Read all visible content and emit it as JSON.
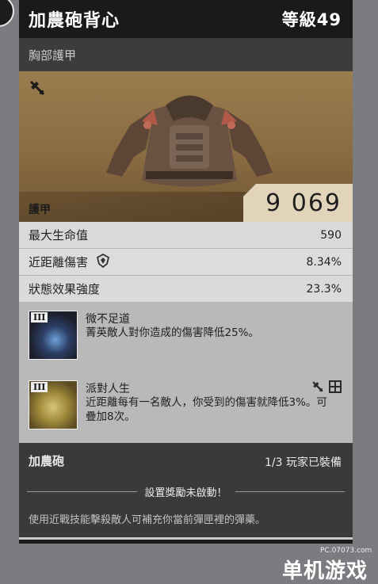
{
  "item": {
    "name": "加農砲背心",
    "level": "等級49",
    "slot": "胸部護甲",
    "armor_label": "護甲",
    "armor_value": "9 069"
  },
  "stats": [
    {
      "label": "最大生命值",
      "value": "590",
      "icon": ""
    },
    {
      "label": "近距離傷害",
      "value": "8.34%",
      "icon": "melee-shield-icon"
    },
    {
      "label": "狀態效果強度",
      "value": "23.3%",
      "icon": ""
    }
  ],
  "talents": [
    {
      "tier": "III",
      "name": "微不足道",
      "description": "菁英敵人對你造成的傷害降低25%。"
    },
    {
      "tier": "III",
      "name": "派對人生",
      "description": "近距離每有一名敵人，你受到的傷害就降低3%。可疊加8次。",
      "icons": [
        "mods-icon",
        "grid-slot-icon"
      ]
    }
  ],
  "gear_set": {
    "name": "加農砲",
    "count": "1/3 玩家已裝備",
    "bonus_status": "設置獎勵未啟動！",
    "description": "使用近戰技能擊殺敵人可補充你當前彈匣裡的彈藥。"
  },
  "watermark": {
    "site": "PC.07073.com",
    "brand": "单机游戏"
  }
}
